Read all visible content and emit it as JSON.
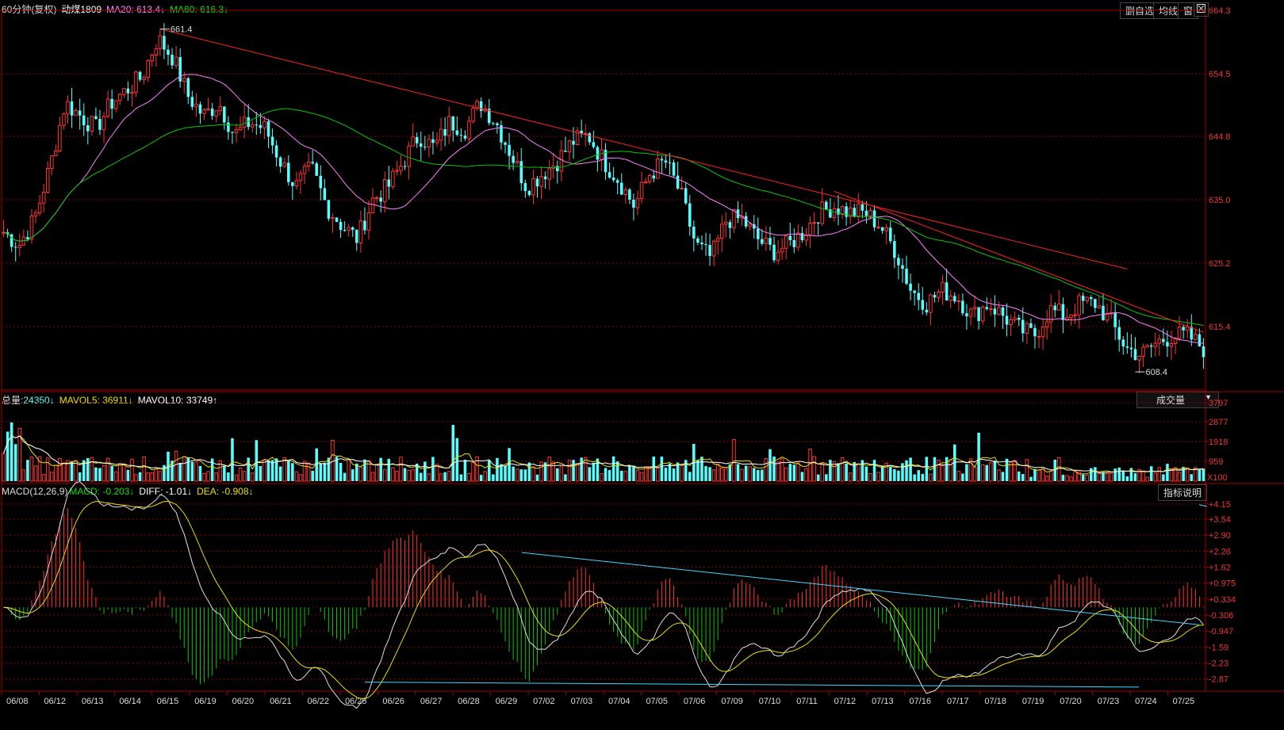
{
  "main_header": {
    "period": "60分钟(复权)",
    "instrument": "动煤1809",
    "ma20_label": "MA20:",
    "ma20_value": "613.4↓",
    "ma60_label": "MA60:",
    "ma60_value": "616.3↓"
  },
  "toolbar": {
    "delete_label": "删自选",
    "ma_line_label": "均线",
    "window_label": "窗",
    "close_icon": "close-box-icon"
  },
  "volume_header": {
    "total_label": "总量:",
    "total_value": "24350↓",
    "mavol5_label": "MAVOL5:",
    "mavol5_value": "36911↓",
    "mavol10_label": "MAVOL10:",
    "mavol10_value": "33749↑",
    "selector_label": "成交量",
    "selector_icon": "caret-down-icon",
    "unit_label": "X100"
  },
  "macd_header": {
    "title": "MACD(12,26,9)",
    "macd_label": "MACD:",
    "macd_value": "-0.203↓",
    "diff_label": "DIFF:",
    "diff_value": "-1.01↓",
    "dea_label": "DEA:",
    "dea_value": "-0.908↓",
    "help_label": "指标说明"
  },
  "chart_data": [
    {
      "type": "candlestick",
      "name": "price",
      "y_ticks": [
        "664.3",
        "654.5",
        "644.8",
        "635.0",
        "625.2",
        "615.4"
      ],
      "ylim": [
        605.6,
        664.3
      ],
      "high_annotation": "661.4",
      "low_annotation": "608.4",
      "dates": [
        "06/08",
        "06/12",
        "06/13",
        "06/14",
        "06/15",
        "06/19",
        "06/20",
        "06/21",
        "06/22",
        "06/25",
        "06/26",
        "06/27",
        "06/28",
        "06/29",
        "07/02",
        "07/03",
        "07/04",
        "07/05",
        "07/06",
        "07/09",
        "07/10",
        "07/11",
        "07/12",
        "07/13",
        "07/16",
        "07/17",
        "07/18",
        "07/19",
        "07/20",
        "07/23",
        "07/24",
        "07/25"
      ],
      "close_path": [
        630,
        628,
        632,
        640,
        650,
        648,
        646,
        650,
        652,
        654,
        660,
        657,
        651,
        648,
        650,
        645,
        647,
        646,
        641,
        637,
        640,
        634,
        631,
        629,
        635,
        637,
        641,
        645,
        643,
        647,
        646,
        650,
        647,
        642,
        637,
        639,
        641,
        644,
        645,
        641,
        638,
        634,
        639,
        641,
        636,
        628,
        626,
        632,
        632,
        629,
        627,
        628,
        630,
        633,
        634,
        633,
        633,
        631,
        627,
        621,
        619,
        621,
        620,
        617,
        619,
        617,
        615,
        614,
        618,
        617,
        619,
        619,
        616,
        612,
        611,
        613,
        614,
        614,
        612
      ]
    },
    {
      "type": "bar",
      "name": "volume",
      "y_ticks": [
        "3797",
        "2877",
        "1918",
        "959"
      ],
      "ylim": [
        0,
        3797
      ]
    },
    {
      "type": "bar+line",
      "name": "macd",
      "y_ticks": [
        "+4.15",
        "+3.54",
        "+2.90",
        "+2.26",
        "+1.62",
        "+0.975",
        "+0.334",
        "-0.306",
        "-0.947",
        "-1.59",
        "-2.23",
        "-2.87"
      ],
      "ylim": [
        -3.3,
        4.4
      ]
    }
  ],
  "colors": {
    "up": "#ff3232",
    "down": "#54ffff",
    "ma20": "#ff80ff",
    "ma60": "#00c800",
    "trend_red": "#ff2020",
    "trend_cyan": "#3ed8ff",
    "diff": "#e0e0e0",
    "dea": "#e8e000",
    "grid": "#8a0000",
    "axis": "#a00000"
  }
}
